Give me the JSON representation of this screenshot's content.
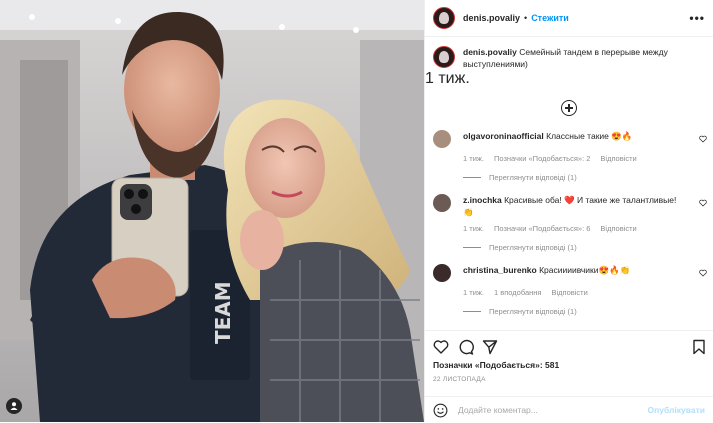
{
  "post": {
    "username": "denis.povaliy",
    "follow_label": "Стежити",
    "more_icon": "more-options-icon",
    "caption": "Семейный тандем в перерыве между выступлениями)",
    "caption_time": "1 тиж.",
    "load_more_icon": "plus-circle-icon"
  },
  "comments": [
    {
      "username": "olgavoroninaofficial",
      "text": "Классные такие 😍🔥",
      "time": "1 тиж.",
      "likes": "Позначки «Подобається»: 2",
      "reply": "Відповісти",
      "replies": "Переглянути відповіді (1)",
      "avatar_color": "#a88f7d"
    },
    {
      "username": "z.inochka",
      "text": "Красивые оба! ❤️ И такие же талантливые! 👏",
      "time": "1 тиж.",
      "likes": "Позначки «Подобається»: 6",
      "reply": "Відповісти",
      "replies": "Переглянути відповіді (1)",
      "avatar_color": "#6c5a55"
    },
    {
      "username": "christina_burenko",
      "text": "Красиииивчики😍🔥👏",
      "time": "1 тиж.",
      "likes": "1 вподобання",
      "reply": "Відповісти",
      "replies": "Переглянути відповіді (1)",
      "avatar_color": "#3a2a2a"
    }
  ],
  "actions": {
    "like_icon": "heart-icon",
    "comment_icon": "comment-icon",
    "share_icon": "share-icon",
    "save_icon": "bookmark-icon"
  },
  "likes_text": "Позначки «Подобається»: 581",
  "date": "22 ЛИСТОПАДА",
  "add_comment": {
    "placeholder": "Додайте коментар...",
    "post_label": "Опублікувати",
    "emoji_icon": "emoji-icon"
  },
  "colors": {
    "link": "#0095f6",
    "muted": "#8e8e8e",
    "post_disabled": "#b2dffc",
    "heart_red": "#ed4956"
  }
}
